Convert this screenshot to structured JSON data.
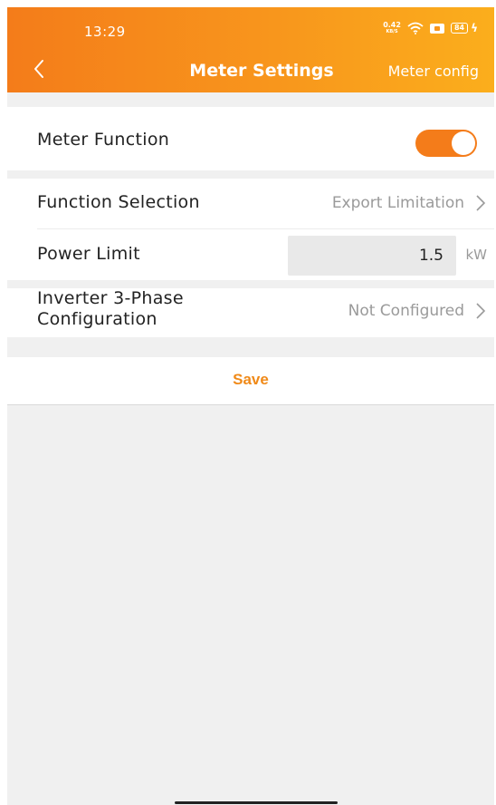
{
  "status_bar": {
    "time": "13:29",
    "net_speed_value": "0.42",
    "net_speed_unit": "KB/S",
    "battery": "84",
    "icons": [
      "wifi-icon",
      "sim-icon",
      "battery-icon",
      "charging-bolt-icon"
    ]
  },
  "header": {
    "title": "Meter Settings",
    "action": "Meter config",
    "back_icon": "chevron-left-icon",
    "gradient_start": "#f47c1a",
    "gradient_end": "#fbae1c"
  },
  "meter_function": {
    "label": "Meter Function",
    "enabled": true,
    "toggle_color": "#f47c1a"
  },
  "function_selection": {
    "label": "Function Selection",
    "value": "Export Limitation",
    "icon": "chevron-right-icon"
  },
  "power_limit": {
    "label": "Power Limit",
    "value": "1.5",
    "unit": "kW"
  },
  "three_phase": {
    "label_line1": "Inverter 3-Phase",
    "label_line2": "Configuration",
    "value": "Not Configured",
    "icon": "chevron-right-icon"
  },
  "save": {
    "label": "Save",
    "color": "#f08a19"
  }
}
